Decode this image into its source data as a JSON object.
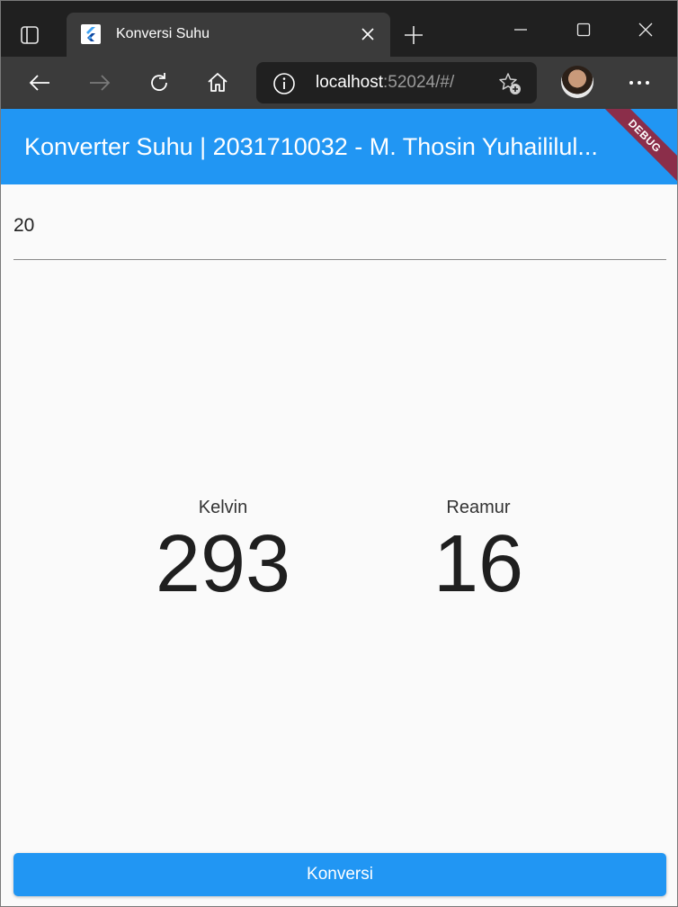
{
  "browser": {
    "tab_title": "Konversi Suhu",
    "url_host": "localhost",
    "url_rest": ":52024/#/"
  },
  "app": {
    "title": "Konverter Suhu | 2031710032 - M. Thosin Yuhaililul...",
    "debug_banner": "DEBUG",
    "input_value": "20",
    "results": [
      {
        "label": "Kelvin",
        "value": "293"
      },
      {
        "label": "Reamur",
        "value": "16"
      }
    ],
    "button_label": "Konversi"
  },
  "colors": {
    "primary": "#2196f3",
    "debug_banner": "#8b2e4a"
  }
}
